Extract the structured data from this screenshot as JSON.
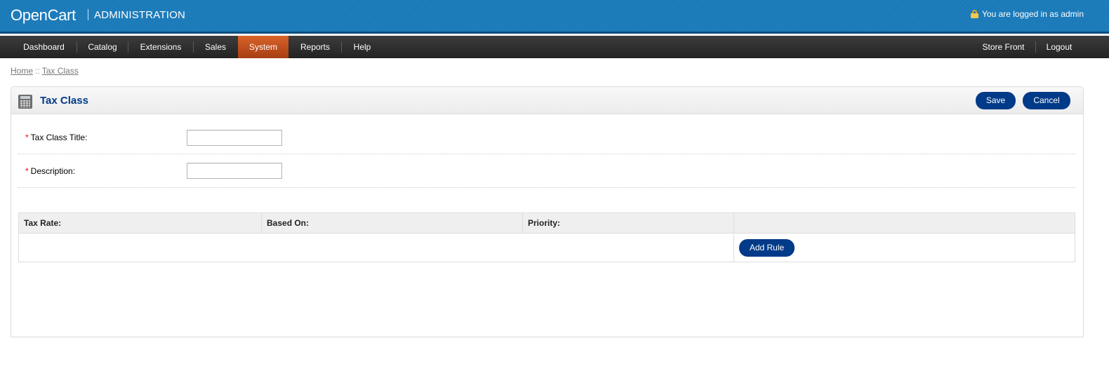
{
  "header": {
    "logo": "OpenCart",
    "logo_sub": "ADMINISTRATION",
    "logged_in_text": "You are logged in as admin",
    "lock_icon": "lock-icon"
  },
  "menu": {
    "items": [
      {
        "label": "Dashboard"
      },
      {
        "label": "Catalog"
      },
      {
        "label": "Extensions"
      },
      {
        "label": "Sales"
      },
      {
        "label": "System",
        "active": true
      },
      {
        "label": "Reports"
      },
      {
        "label": "Help"
      }
    ],
    "right": [
      {
        "label": "Store Front"
      },
      {
        "label": "Logout"
      }
    ],
    "active_color": "#c9511d"
  },
  "breadcrumb": {
    "home": "Home",
    "separator": "::",
    "current": "Tax Class"
  },
  "box": {
    "title": "Tax Class",
    "icon": "calculator-icon",
    "save_label": "Save",
    "cancel_label": "Cancel"
  },
  "form": {
    "fields": [
      {
        "required_mark": "*",
        "label": "Tax Class Title:",
        "value": "",
        "placeholder": ""
      },
      {
        "required_mark": "*",
        "label": "Description:",
        "value": "",
        "placeholder": ""
      }
    ]
  },
  "rules_table": {
    "headers": [
      "Tax Rate:",
      "Based On:",
      "Priority:",
      ""
    ],
    "add_rule_label": "Add Rule"
  },
  "colors": {
    "header_blue": "#1e7cbb",
    "button_blue": "#003a88",
    "title_blue": "#003a88",
    "required_red": "#ff0000"
  }
}
